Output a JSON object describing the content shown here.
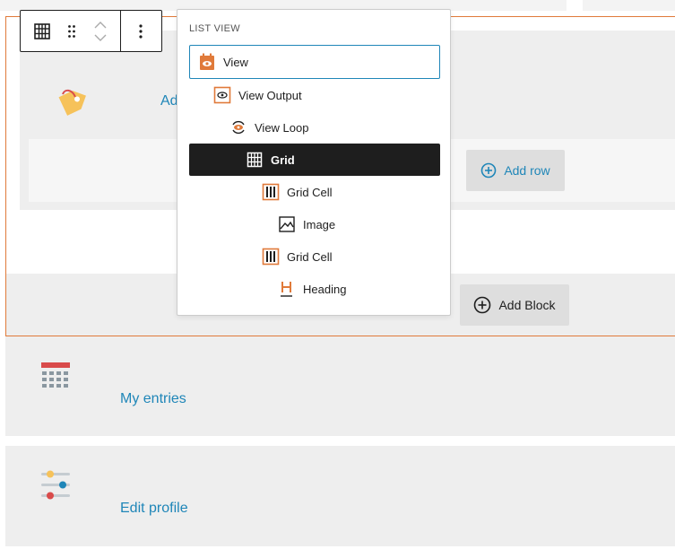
{
  "list_view": {
    "title": "LIST VIEW",
    "items": [
      {
        "label": "View",
        "icon": "view-calendar-icon"
      },
      {
        "label": "View Output",
        "icon": "eye-icon"
      },
      {
        "label": "View Loop",
        "icon": "loop-eye-icon"
      },
      {
        "label": "Grid",
        "icon": "grid-icon"
      },
      {
        "label": "Grid Cell",
        "icon": "grid-cell-icon"
      },
      {
        "label": "Image",
        "icon": "image-icon"
      },
      {
        "label": "Grid Cell",
        "icon": "grid-cell-icon"
      },
      {
        "label": "Heading",
        "icon": "heading-icon"
      }
    ]
  },
  "editor": {
    "partial_link": "Ad",
    "add_row_label": "Add row",
    "add_block_label": "Add Block"
  },
  "cards": [
    {
      "label": "My entries",
      "icon": "calendar-icon"
    },
    {
      "label": "Edit profile",
      "icon": "sliders-icon"
    }
  ],
  "colors": {
    "accent_orange": "#e07a3a",
    "link_blue": "#1f86b8",
    "selected_dark": "#1e1e1e",
    "focus_blue": "#1f86b8"
  }
}
